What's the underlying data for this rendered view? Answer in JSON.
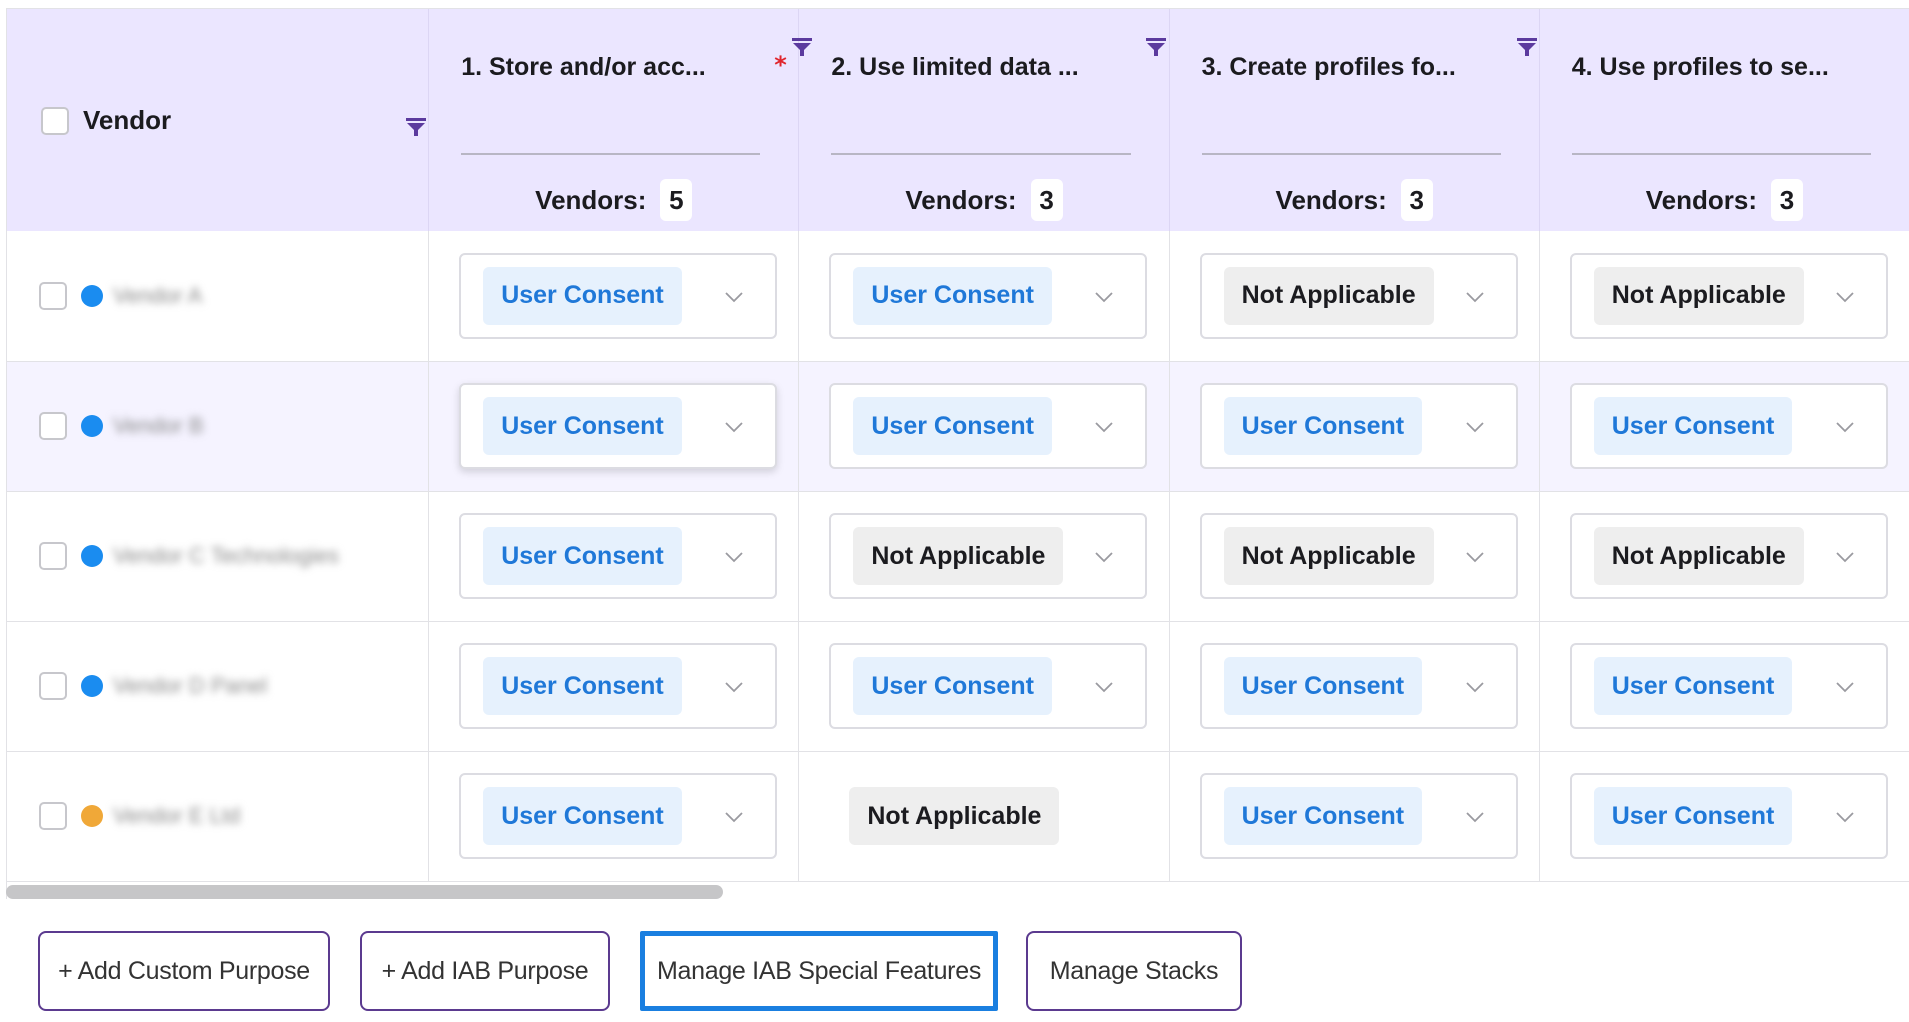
{
  "header": {
    "vendor_label": "Vendor",
    "purposes": [
      {
        "title": "1. Store and/or acc...",
        "required": true,
        "vendors_label": "Vendors:",
        "vendor_count": "5"
      },
      {
        "title": "2. Use limited data ...",
        "required": false,
        "vendors_label": "Vendors:",
        "vendor_count": "3"
      },
      {
        "title": "3. Create profiles fo...",
        "required": false,
        "vendors_label": "Vendors:",
        "vendor_count": "3"
      },
      {
        "title": "4. Use profiles to se...",
        "required": false,
        "vendors_label": "Vendors:",
        "vendor_count": "3"
      }
    ],
    "required_marker": "*"
  },
  "rows": [
    {
      "vendor_name": "Vendor A",
      "dot_color": "#1a8cf0",
      "cells": [
        "User Consent",
        "User Consent",
        "Not Applicable",
        "Not Applicable"
      ]
    },
    {
      "vendor_name": "Vendor B",
      "dot_color": "#1a8cf0",
      "cells": [
        "User Consent",
        "User Consent",
        "User Consent",
        "User Consent"
      ]
    },
    {
      "vendor_name": "Vendor C Technologies",
      "dot_color": "#1a8cf0",
      "cells": [
        "User Consent",
        "Not Applicable",
        "Not Applicable",
        "Not Applicable"
      ]
    },
    {
      "vendor_name": "Vendor D Panel",
      "dot_color": "#1a8cf0",
      "cells": [
        "User Consent",
        "User Consent",
        "User Consent",
        "User Consent"
      ]
    },
    {
      "vendor_name": "Vendor E Ltd",
      "dot_color": "#f0a838",
      "cells": [
        "User Consent",
        "Not Applicable",
        "User Consent",
        "User Consent"
      ]
    }
  ],
  "footer": {
    "add_custom_purpose": "+ Add Custom Purpose",
    "add_iab_purpose": "+ Add IAB Purpose",
    "manage_special_features": "Manage IAB Special Features",
    "manage_stacks": "Manage Stacks"
  },
  "colors": {
    "header_bg": "#ebe6ff",
    "filter_icon": "#5b3a9e",
    "consent_text": "#1f78d8",
    "consent_bg": "#e6f1fd",
    "na_bg": "#eeeeee",
    "active_button_border": "#1a7fe0",
    "button_border": "#5b3a8f"
  }
}
